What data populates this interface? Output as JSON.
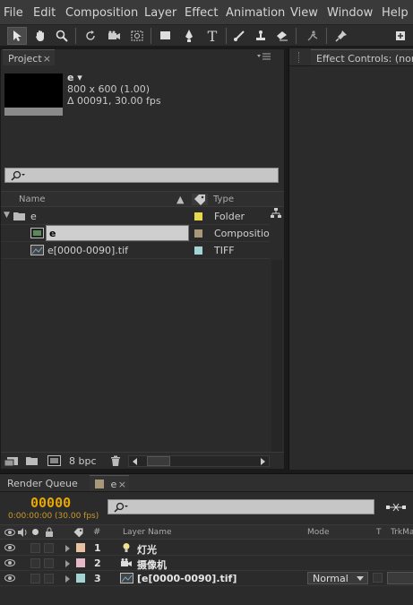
{
  "menu": [
    "File",
    "Edit",
    "Composition",
    "Layer",
    "Effect",
    "Animation",
    "View",
    "Window",
    "Help"
  ],
  "project_panel": {
    "tab_label": "Project",
    "comp_name": "e ▾",
    "comp_size": "800 x 600 (1.00)",
    "comp_duration": "Δ 00091, 30.00 fps",
    "columns": {
      "name": "Name",
      "type": "Type"
    },
    "items": [
      {
        "name": "e",
        "type": "Folder",
        "color": "#e8d94a"
      },
      {
        "name": "e",
        "type": "Compositio",
        "color": "#a99879"
      },
      {
        "name": "e[0000-0090].tif",
        "type": "TIFF",
        "color": "#a4d3d3"
      }
    ],
    "bpc_label": "8 bpc"
  },
  "effect_controls": {
    "tab_label": "Effect Controls: (non"
  },
  "timeline": {
    "render_queue_tab": "Render Queue",
    "comp_tab": "e",
    "timecode": "00000",
    "timecode_sub": "0:00:00:00 (30.00 fps)",
    "columns": {
      "hash": "#",
      "layer_name": "Layer Name",
      "mode": "Mode",
      "t": "T",
      "trkmat": "TrkMa"
    },
    "layers": [
      {
        "num": "1",
        "name": "灯光",
        "color": "#e8c2a0",
        "icon": "light-icon"
      },
      {
        "num": "2",
        "name": "摄像机",
        "color": "#e6b9c9",
        "icon": "camera-icon"
      },
      {
        "num": "3",
        "name": "[e[0000-0090].tif]",
        "color": "#a4d3d3",
        "icon": "footage-icon",
        "mode": "Normal"
      }
    ]
  }
}
